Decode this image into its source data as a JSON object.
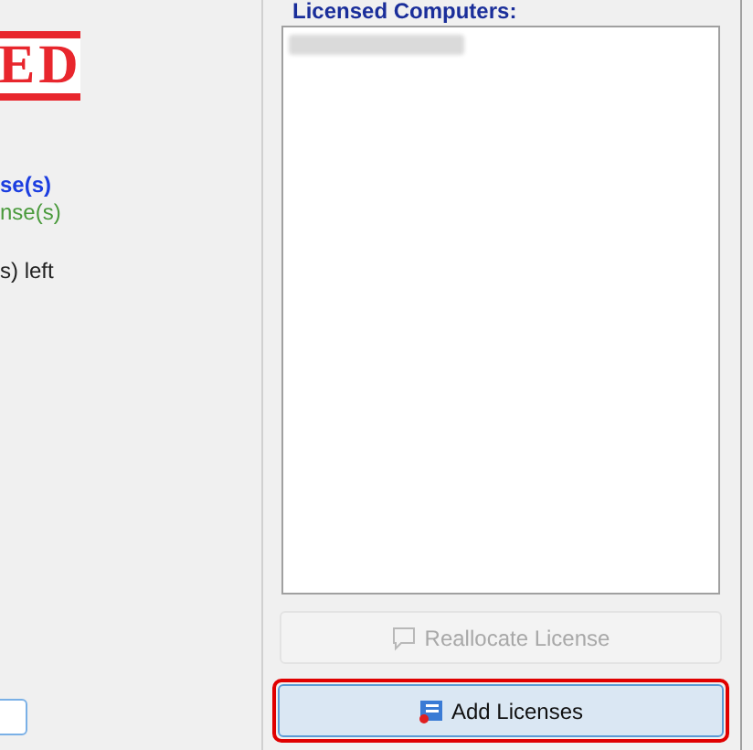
{
  "left_panel": {
    "stamp": "ED",
    "lines": [
      {
        "text": "se(s)",
        "kind": "blue"
      },
      {
        "text": "nse(s)",
        "kind": "green"
      },
      {
        "text": "s) left",
        "kind": "plain"
      }
    ]
  },
  "right_panel": {
    "list_label": "Licensed Computers:",
    "buttons": [
      {
        "label": "Reallocate License",
        "disabled": true,
        "highlighted": false,
        "kind": "comment"
      },
      {
        "label": "Add Licenses",
        "disabled": false,
        "highlighted": true,
        "kind": "certificate"
      }
    ]
  }
}
